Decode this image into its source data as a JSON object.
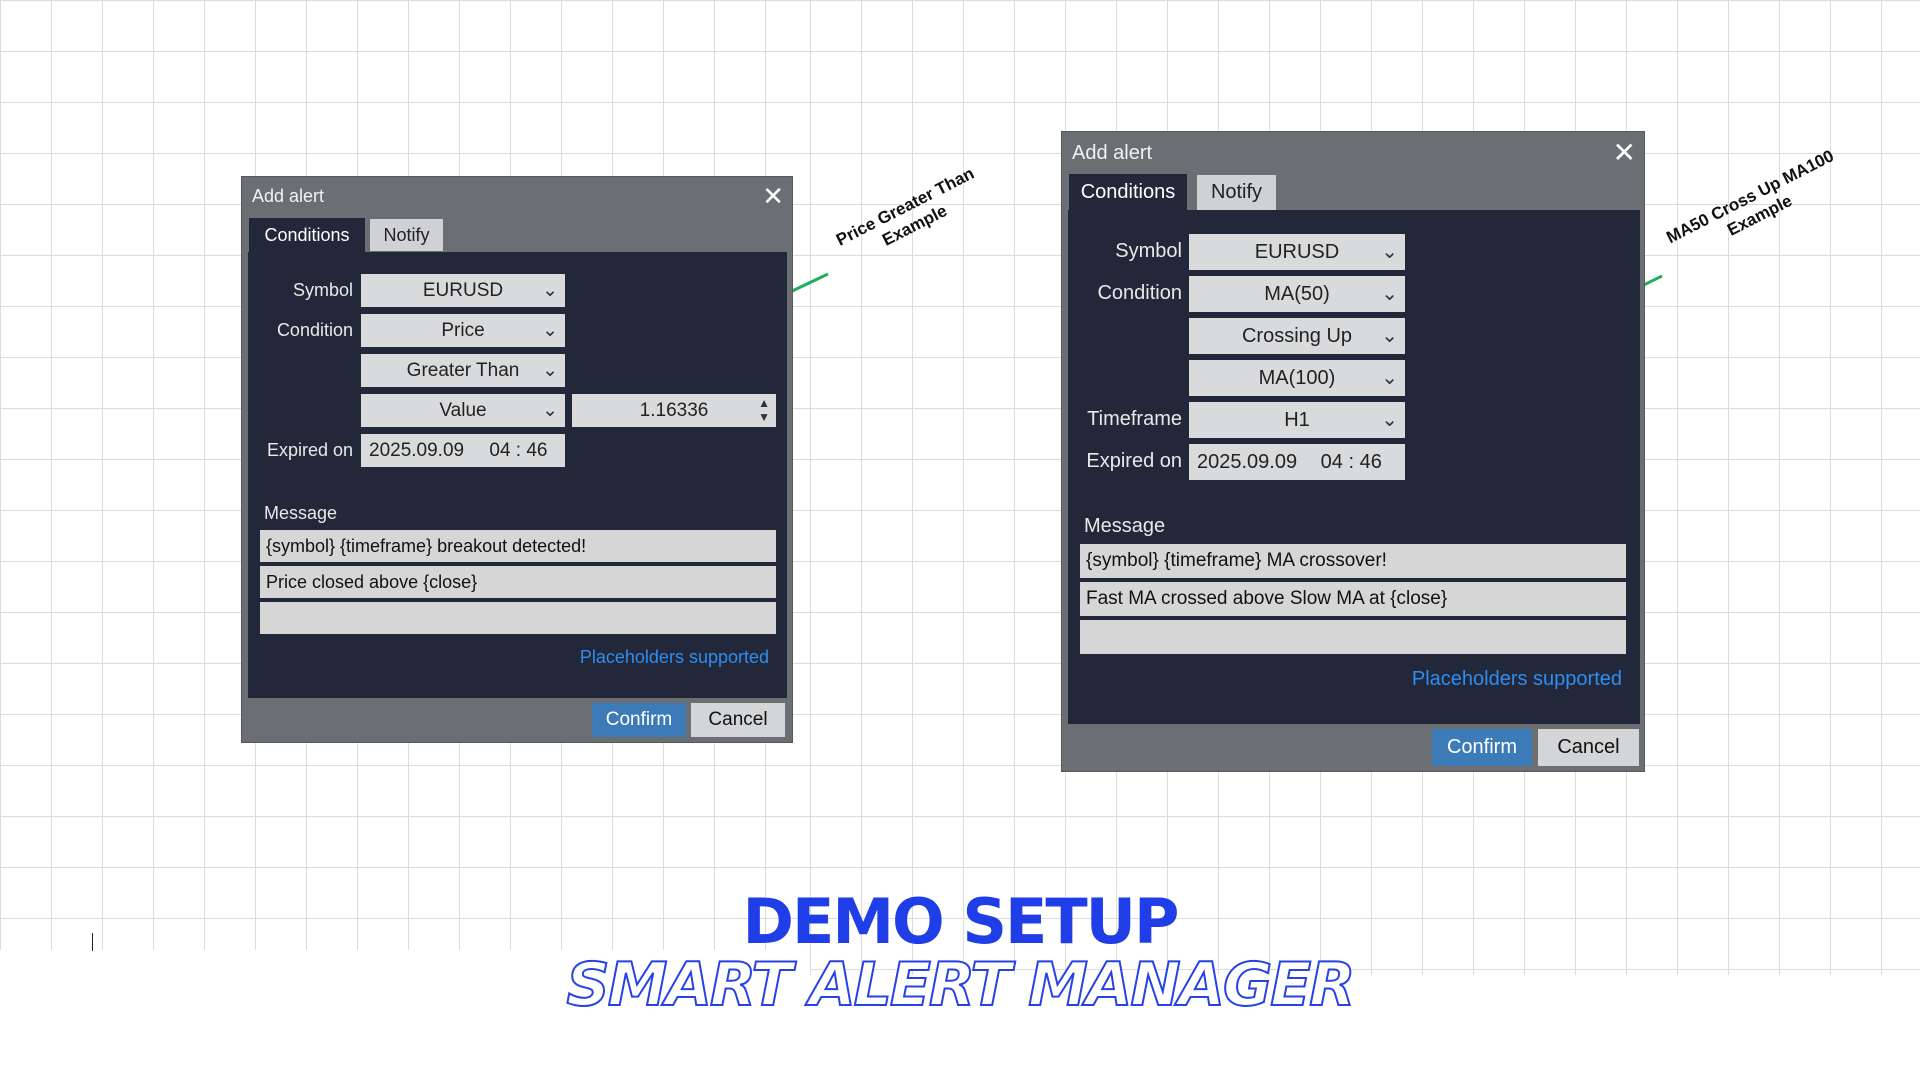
{
  "colors": {
    "accent": "#3d7ab8",
    "link": "#2f8df0",
    "panel": "#22283a",
    "frame": "#6b6e72",
    "annotation_line": "#1fae5b",
    "heading": "#1f3ee8"
  },
  "dialog_left": {
    "title": "Add alert",
    "close_icon": "close-icon",
    "tabs": [
      {
        "label": "Conditions",
        "active": true
      },
      {
        "label": "Notify",
        "active": false
      }
    ],
    "symbol_label": "Symbol",
    "symbol_value": "EURUSD",
    "condition_label": "Condition",
    "condition_value": "Price",
    "operator_value": "Greater Than",
    "compare_value": "Value",
    "number_value": "1.16336",
    "expired_label": "Expired on",
    "expired_date": "2025.09.09",
    "expired_time": "04 : 46",
    "message_label": "Message",
    "message_lines": [
      "{symbol} {timeframe} breakout detected!",
      "Price closed above {close}",
      ""
    ],
    "placeholders_link": "Placeholders supported",
    "confirm": "Confirm",
    "cancel": "Cancel"
  },
  "dialog_right": {
    "title": "Add alert",
    "close_icon": "close-icon",
    "tabs": [
      {
        "label": "Conditions",
        "active": true
      },
      {
        "label": "Notify",
        "active": false
      }
    ],
    "symbol_label": "Symbol",
    "symbol_value": "EURUSD",
    "condition_label": "Condition",
    "condition_value": "MA(50)",
    "operator_value": "Crossing Up",
    "compare_value": "MA(100)",
    "timeframe_label": "Timeframe",
    "timeframe_value": "H1",
    "expired_label": "Expired on",
    "expired_date": "2025.09.09",
    "expired_time": "04 : 46",
    "message_label": "Message",
    "message_lines": [
      "{symbol} {timeframe} MA crossover!",
      "Fast MA crossed above Slow MA at {close}",
      ""
    ],
    "placeholders_link": "Placeholders supported",
    "confirm": "Confirm",
    "cancel": "Cancel"
  },
  "annotations": {
    "left": [
      "Price Greater Than",
      "Example"
    ],
    "right": [
      "MA50 Cross Up MA100",
      "Example"
    ]
  },
  "footer": {
    "title": "DEMO SETUP",
    "subtitle": "SMART ALERT MANAGER"
  }
}
